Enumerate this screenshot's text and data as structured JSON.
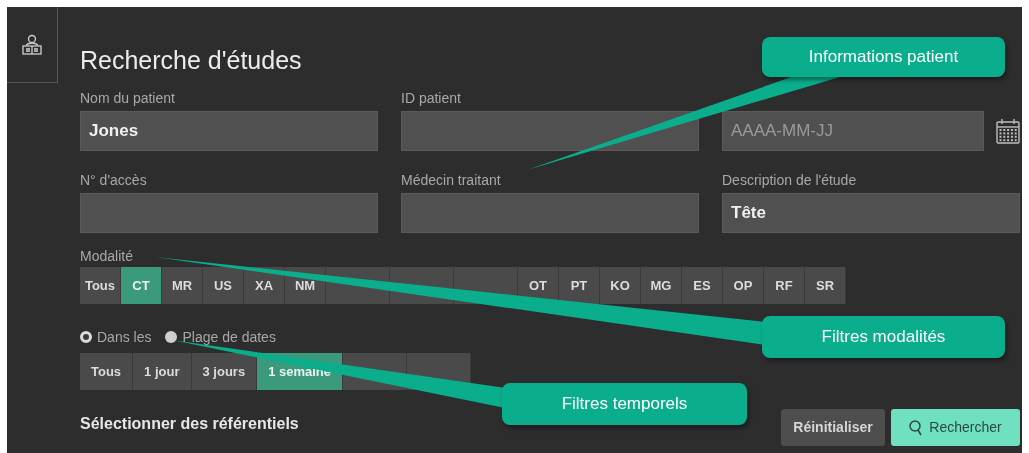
{
  "title": "Recherche d'études",
  "fields": [
    {
      "label": "Nom du patient",
      "value": "Jones"
    },
    {
      "label": "ID patient"
    },
    {
      "placeholder": "AAAA-MM-JJ",
      "kind": "date"
    },
    {
      "label": "N° d'accès"
    },
    {
      "label": "Médecin traitant"
    },
    {
      "label": "Description de l'étude",
      "value": "Tête"
    }
  ],
  "modality": {
    "label": "Modalité",
    "options": [
      {
        "label": "Tous",
        "selected": false
      },
      {
        "label": "CT",
        "selected": true
      },
      {
        "label": "MR",
        "selected": false
      },
      {
        "label": "US",
        "selected": false
      },
      {
        "label": "XA",
        "selected": false
      },
      {
        "label": "NM",
        "selected": false
      },
      {
        "selected": false
      },
      {
        "selected": false
      },
      {
        "selected": false
      },
      {
        "label": "OT",
        "selected": false
      },
      {
        "label": "PT",
        "selected": false
      },
      {
        "label": "KO",
        "selected": false
      },
      {
        "label": "MG",
        "selected": false
      },
      {
        "label": "ES",
        "selected": false
      },
      {
        "label": "OP",
        "selected": false
      },
      {
        "label": "RF",
        "selected": false
      },
      {
        "label": "SR",
        "selected": false
      }
    ]
  },
  "date_mode": [
    {
      "label": "Dans les",
      "selected": true
    },
    {
      "label": "Plage de dates",
      "selected": false
    }
  ],
  "periods": [
    {
      "label": "Tous",
      "selected": false
    },
    {
      "label": "1 jour",
      "selected": false
    },
    {
      "label": "3 jours",
      "selected": false
    },
    {
      "label": "1 semaine",
      "selected": true
    },
    {
      "selected": false
    },
    {
      "selected": false
    }
  ],
  "repositories_heading": "Sélectionner des référentiels",
  "buttons": [
    {
      "label": "Réinitialiser",
      "kind": "reset"
    },
    {
      "label": "Rechercher",
      "kind": "search"
    }
  ],
  "callouts": [
    {
      "text": "Informations patient"
    },
    {
      "text": "Filtres modalités"
    },
    {
      "text": "Filtres temporels"
    }
  ]
}
